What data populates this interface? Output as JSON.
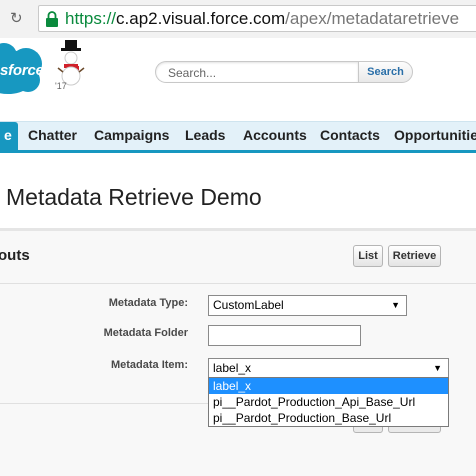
{
  "browser": {
    "url_scheme": "https://",
    "url_host": "c.ap2.visual.force.com",
    "url_path": "/apex/metadataretrieve"
  },
  "header": {
    "logo_text": "sforce",
    "logo_year": "'17",
    "search_placeholder": "Search...",
    "search_button": "Search"
  },
  "tabs": [
    {
      "label": "e",
      "active": true
    },
    {
      "label": "Chatter"
    },
    {
      "label": "Campaigns"
    },
    {
      "label": "Leads"
    },
    {
      "label": "Accounts"
    },
    {
      "label": "Contacts"
    },
    {
      "label": "Opportunities"
    }
  ],
  "page": {
    "title": "Metadata Retrieve Demo"
  },
  "section": {
    "title": "outs",
    "list_button": "List",
    "retrieve_button": "Retrieve",
    "fields": {
      "metadata_type_label": "Metadata Type:",
      "metadata_type_value": "CustomLabel",
      "metadata_folder_label": "Metadata Folder",
      "metadata_folder_value": "",
      "metadata_item_label": "Metadata Item:",
      "metadata_item_value": "label_x"
    },
    "dropdown_options": [
      "label_x",
      "pi__Pardot_Production_Api_Base_Url",
      "pi__Pardot_Production_Base_Url"
    ]
  },
  "colors": {
    "tab_active": "#1797c0",
    "tabbar_bg": "#e3f1f9",
    "url_scheme": "#0a8a3d",
    "dropdown_selected": "#1e90ff"
  }
}
